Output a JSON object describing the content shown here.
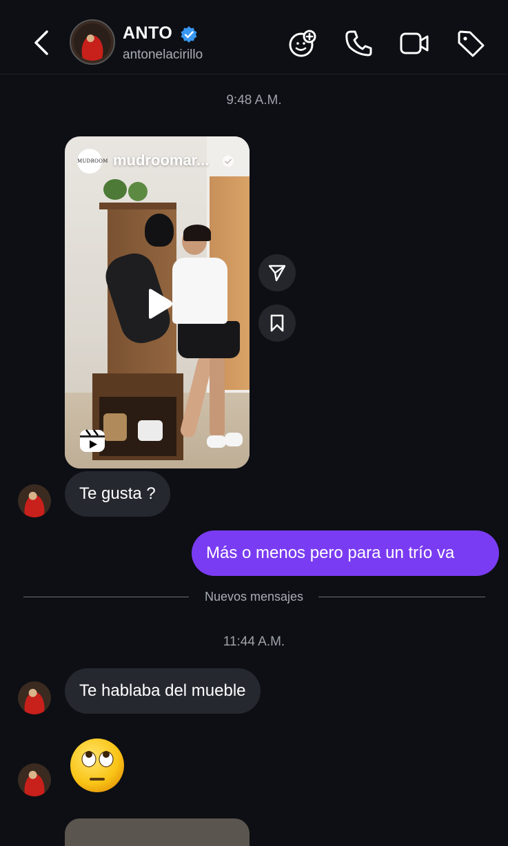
{
  "header": {
    "contact_name": "ANTO",
    "username": "antonelacirillo"
  },
  "timestamps": {
    "first": "9:48 A.M.",
    "second": "11:44 A.M."
  },
  "shared_reel": {
    "account": "mudroomar...",
    "logo_text": "MUDROOM"
  },
  "messages": [
    {
      "from": "contact",
      "text": "Te gusta ?"
    },
    {
      "from": "me",
      "text": "Más o menos pero para un trío va"
    },
    {
      "from": "contact",
      "text": "Te hablaba del mueble"
    },
    {
      "from": "contact",
      "text": "🙄"
    }
  ],
  "divider": {
    "label": "Nuevos mensajes"
  },
  "colors": {
    "background": "#0d0f14",
    "outgoing_bubble": "#7a3cf2",
    "incoming_bubble": "#262830",
    "verified_badge": "#3897f0"
  },
  "icons": [
    "back-icon",
    "verified-icon",
    "effects-icon",
    "phone-icon",
    "video-icon",
    "tag-icon",
    "share-icon",
    "bookmark-icon",
    "play-icon",
    "reels-icon"
  ]
}
